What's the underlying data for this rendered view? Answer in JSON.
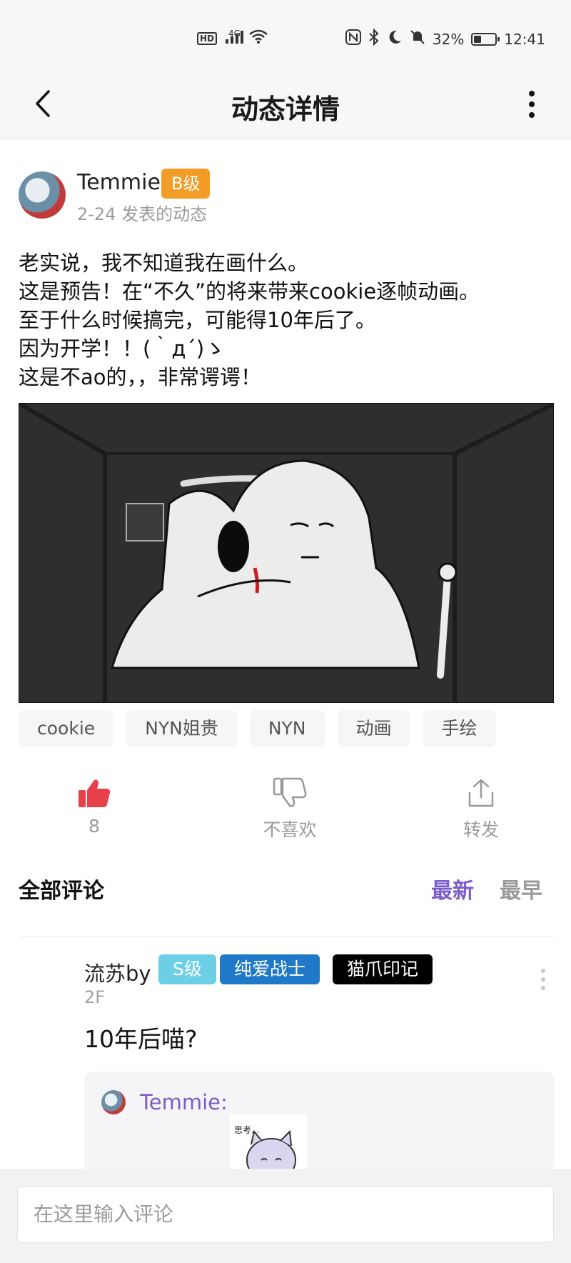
{
  "status_bar": {
    "network_left": "HD",
    "signal": "4G",
    "wifi": "6",
    "battery": "32%",
    "time": "12:41",
    "icons": [
      "hd-icon",
      "signal-icon",
      "wifi-icon",
      "nfc-icon",
      "bluetooth-icon",
      "moon-icon",
      "mute-icon",
      "battery-icon"
    ]
  },
  "header": {
    "title": "动态详情",
    "back_icon": "chevron-left-icon",
    "more_icon": "more-vertical-icon"
  },
  "author": {
    "name": "Temmie",
    "level": "B级",
    "time": "2-24 发表的动态"
  },
  "post": {
    "lines": [
      "老实说，我不知道我在画什么。",
      "这是预告！在“不久”的将来带来cookie逐帧动画。",
      "至于什么时候搞完，可能得10年后了。",
      "因为开学！！(｀д´)ゝ",
      "这是不ao的，，非常谔谔！"
    ]
  },
  "tags": [
    "cookie",
    "NYN姐贵",
    "NYN",
    "动画",
    "手绘"
  ],
  "actions": {
    "like_count": "8",
    "dislike_label": "不喜欢",
    "share_label": "转发",
    "like_color": "#e8404a"
  },
  "comments": {
    "title": "全部评论",
    "sort_newest": "最新",
    "sort_earliest": "最早",
    "accent": "#7b5cc9",
    "first": {
      "name": "流苏by",
      "badges": [
        "S级",
        "纯爱战士",
        "猫爪印记"
      ],
      "floor": "2F",
      "text": "10年后喵?",
      "reply_name": "Temmie:",
      "sticker_text": "思考..."
    }
  },
  "input": {
    "placeholder": "在这里输入评论"
  }
}
